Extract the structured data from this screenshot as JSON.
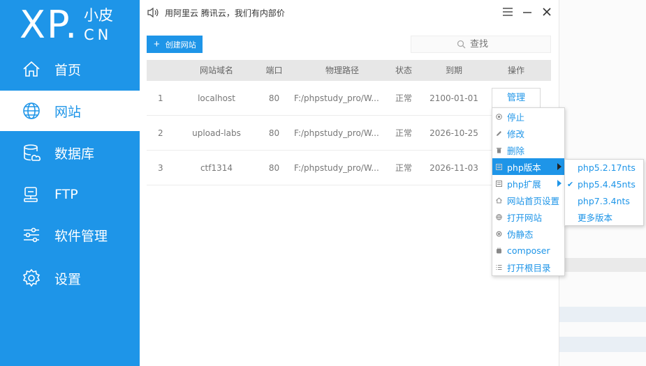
{
  "sidebar": {
    "logo": {
      "main": "XP.",
      "small": "小皮",
      "cn": "CN"
    },
    "items": [
      {
        "label": "首页",
        "icon": "home-icon",
        "active": false
      },
      {
        "label": "网站",
        "icon": "globe-icon",
        "active": true
      },
      {
        "label": "数据库",
        "icon": "database-icon",
        "active": false
      },
      {
        "label": "FTP",
        "icon": "ftp-server-icon",
        "active": false
      },
      {
        "label": "软件管理",
        "icon": "sliders-icon",
        "active": false
      },
      {
        "label": "设置",
        "icon": "gear-icon",
        "active": false
      }
    ]
  },
  "topbar": {
    "notice": "用阿里云 腾讯云，我们有内部价"
  },
  "toolbar": {
    "create_label": "创建网站",
    "search_placeholder": "查找"
  },
  "table": {
    "headers": [
      "网站域名",
      "端口",
      "物理路径",
      "状态",
      "到期",
      "操作"
    ],
    "rows": [
      {
        "index": "1",
        "domain": "localhost",
        "port": "80",
        "path": "F:/phpstudy_pro/W...",
        "status": "正常",
        "expire": "2100-01-01",
        "action": "管理"
      },
      {
        "index": "2",
        "domain": "upload-labs",
        "port": "80",
        "path": "F:/phpstudy_pro/W...",
        "status": "正常",
        "expire": "2026-10-25",
        "action": ""
      },
      {
        "index": "3",
        "domain": "ctf1314",
        "port": "80",
        "path": "F:/phpstudy_pro/W...",
        "status": "正常",
        "expire": "2026-11-03",
        "action": ""
      }
    ]
  },
  "context_menu": {
    "items": [
      {
        "label": "停止",
        "icon": "stop-icon"
      },
      {
        "label": "修改",
        "icon": "edit-icon"
      },
      {
        "label": "删除",
        "icon": "trash-icon"
      },
      {
        "label": "php版本",
        "icon": "php-icon",
        "submenu": true,
        "highlighted": true
      },
      {
        "label": "php扩展",
        "icon": "extension-icon",
        "submenu": true
      },
      {
        "label": "网站首页设置",
        "icon": "home-small-icon"
      },
      {
        "label": "打开网站",
        "icon": "globe-small-icon"
      },
      {
        "label": "伪静态",
        "icon": "rewrite-icon"
      },
      {
        "label": "composer",
        "icon": "composer-icon"
      },
      {
        "label": "打开根目录",
        "icon": "list-icon"
      }
    ]
  },
  "php_versions": {
    "items": [
      {
        "label": "php5.2.17nts",
        "checked": false
      },
      {
        "label": "php5.4.45nts",
        "checked": true
      },
      {
        "label": "php7.3.4nts",
        "checked": false
      },
      {
        "label": "更多版本",
        "checked": false
      }
    ]
  },
  "colors": {
    "accent": "#1e95e8",
    "sidebar_bg": "#1e95e8",
    "active_bg": "#ffffff"
  }
}
